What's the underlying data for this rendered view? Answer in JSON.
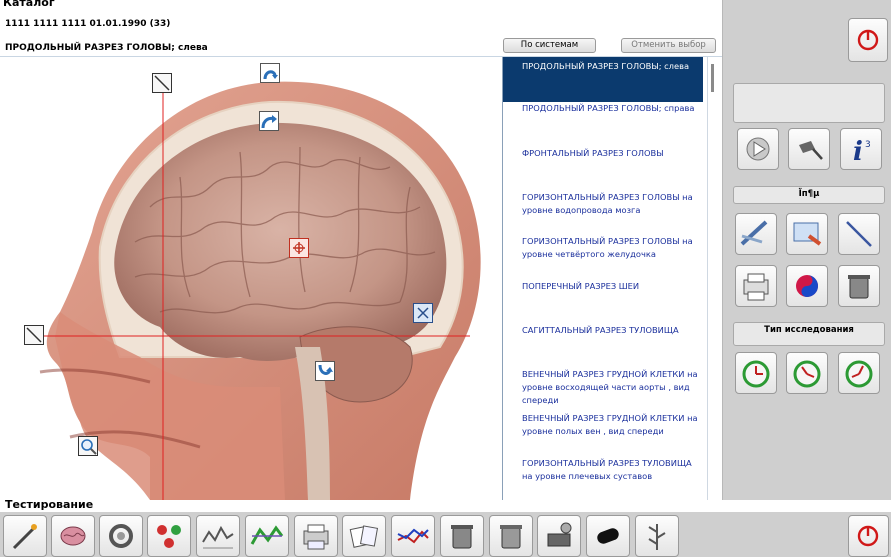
{
  "header": {
    "title": "Каталог",
    "patient": "1111  1111  1111  01.01.1990 (33)",
    "view_name": "ПРОДОЛЬНЫЙ  РАЗРЕЗ  ГОЛОВЫ; слева",
    "by_systems_label": "По системам",
    "deselect_label": "Отменить выбор"
  },
  "sections": [
    {
      "label": "ПРОДОЛЬНЫЙ  РАЗРЕЗ  ГОЛОВЫ; слева",
      "selected": true
    },
    {
      "label": "ПРОДОЛЬНЫЙ  РАЗРЕЗ  ГОЛОВЫ; справа",
      "selected": false
    },
    {
      "label": "ФРОНТАЛЬНЫЙ  РАЗРЕЗ  ГОЛОВЫ",
      "selected": false
    },
    {
      "label": "ГОРИЗОНТАЛЬНЫЙ  РАЗРЕЗ  ГОЛОВЫ на уровне водопровода мозга",
      "selected": false
    },
    {
      "label": "ГОРИЗОНТАЛЬНЫЙ  РАЗРЕЗ  ГОЛОВЫ  на уровне  четвёртого  желудочка",
      "selected": false
    },
    {
      "label": "ПОПЕРЕЧНЫЙ  РАЗРЕЗ  ШЕИ",
      "selected": false
    },
    {
      "label": "САГИТТАЛЬНЫЙ  РАЗРЕЗ  ТУЛОВИЩА",
      "selected": false
    },
    {
      "label": "ВЕНЕЧНЫЙ  РАЗРЕЗ  ГРУДНОЙ  КЛЕТКИ  на уровне  восходящей  части  аорты ,  вид спереди",
      "selected": false
    },
    {
      "label": "ВЕНЕЧНЫЙ  РАЗРЕЗ  ГРУДНОЙ  КЛЕТКИ  на уровне  полых  вен ,  вид  спереди",
      "selected": false
    },
    {
      "label": "ГОРИЗОНТАЛЬНЫЙ  РАЗРЕЗ  ТУЛОВИЩА  на  уровне  плечевых  суставов",
      "selected": false
    }
  ],
  "right_panel": {
    "section2_label": "Їп¶µ",
    "section3_label": "Тип исследования"
  },
  "bottom": {
    "label": "Тестирование"
  },
  "colors": {
    "selected_bg": "#0b3a6e",
    "list_text": "#1a2f9c",
    "crosshair": "#e02020",
    "panel_bg": "#cfcfcf"
  }
}
